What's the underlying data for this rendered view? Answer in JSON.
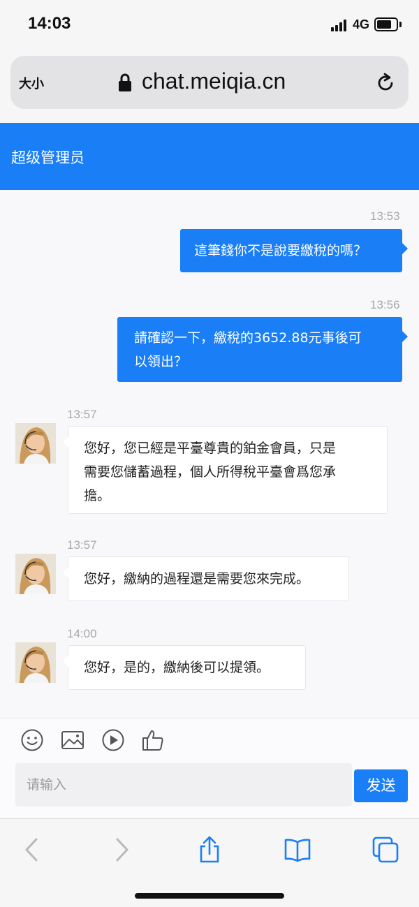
{
  "status_bar": {
    "time": "14:03",
    "network": "4G",
    "icons": [
      "signal-icon",
      "battery-icon"
    ]
  },
  "browser": {
    "text_size_label": "大小",
    "url": "chat.meiqia.cn",
    "icons": [
      "lock-icon",
      "reload-icon"
    ]
  },
  "header": {
    "title": "超级管理员"
  },
  "messages": [
    {
      "direction": "out",
      "time": "13:53",
      "lines": [
        "這筆錢你不是說要繳稅的嗎？"
      ]
    },
    {
      "direction": "out",
      "time": "13:56",
      "lines": [
        "請確認一下，繳稅的3652.88元事後可",
        "以領出？"
      ]
    },
    {
      "direction": "in",
      "time": "13:57",
      "lines": [
        "您好，您已經是平臺尊貴的鉑金會員，只是",
        "需要您儲蓄過程，個人所得稅平臺會爲您承",
        "擔。"
      ]
    },
    {
      "direction": "in",
      "time": "13:57",
      "lines": [
        "您好，繳納的過程還是需要您來完成。"
      ]
    },
    {
      "direction": "in",
      "time": "14:00",
      "lines": [
        "您好，是的，繳納後可以提領。"
      ]
    }
  ],
  "composer": {
    "placeholder": "请输入",
    "send_label": "发送",
    "tools": [
      "emoji-icon",
      "image-icon",
      "video-icon",
      "thumbs-up-icon"
    ]
  },
  "toolbar": {
    "icons": [
      "back-icon",
      "forward-icon",
      "share-icon",
      "bookmarks-icon",
      "tabs-icon"
    ]
  },
  "colors": {
    "accent": "#1a7ef7",
    "background": "#f8f8fa"
  }
}
